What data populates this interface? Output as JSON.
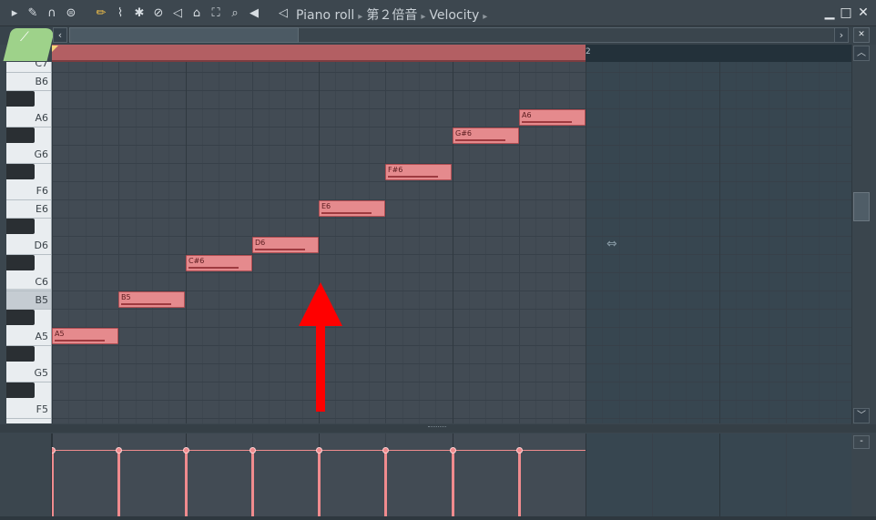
{
  "toolbar": {
    "icons": [
      "play-menu-icon",
      "wrench-icon",
      "magnet-icon",
      "options-icon",
      "draw-pencil-icon",
      "paint-brush-icon",
      "delete-icon",
      "mute-icon",
      "slice-icon",
      "select-icon",
      "zoom-icon",
      "playback-icon"
    ],
    "speaker_icon": "speaker-icon",
    "breadcrumb": [
      "Piano roll",
      "第２倍音",
      "Velocity"
    ],
    "window_buttons": {
      "minimize": "▁",
      "maximize": "□",
      "close": "✕"
    }
  },
  "timeline": {
    "bar_label": "2",
    "selection_color": "#b35f63"
  },
  "keyboard": {
    "labels": [
      "C7",
      "B6",
      "A6",
      "G6",
      "F6",
      "E6",
      "D6",
      "C6",
      "B5",
      "A5",
      "G5",
      "F5"
    ]
  },
  "notes": [
    {
      "label": "A5",
      "color": "#e58a8d"
    },
    {
      "label": "B5",
      "color": "#e58a8d"
    },
    {
      "label": "C#6",
      "color": "#e58a8d"
    },
    {
      "label": "D6",
      "color": "#e58a8d"
    },
    {
      "label": "E6",
      "color": "#e58a8d"
    },
    {
      "label": "F#6",
      "color": "#e58a8d"
    },
    {
      "label": "G#6",
      "color": "#e58a8d"
    },
    {
      "label": "A6",
      "color": "#e58a8d"
    }
  ],
  "event_editor": {
    "parameter": "Velocity",
    "stem_color": "#f08b8e"
  },
  "annotation": {
    "arrow_color": "#ff0000",
    "direction": "up"
  }
}
